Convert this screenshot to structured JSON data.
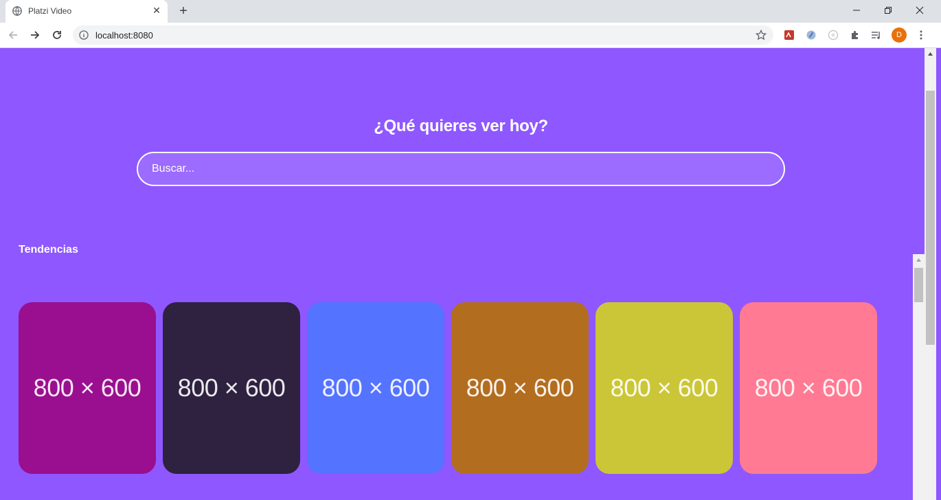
{
  "browser": {
    "tab_title": "Platzi Video",
    "url": "localhost:8080",
    "profile_initial": "D"
  },
  "hero": {
    "title": "¿Qué quieres ver hoy?",
    "search_placeholder": "Buscar..."
  },
  "trending": {
    "title": "Tendencias",
    "cards": [
      {
        "label": "800 × 600",
        "color": "#9a0f8f"
      },
      {
        "label": "800 × 600",
        "color": "#2e2240"
      },
      {
        "label": "800 × 600",
        "color": "#5473ff"
      },
      {
        "label": "800 × 600",
        "color": "#b36d1f"
      },
      {
        "label": "800 × 600",
        "color": "#cbc637"
      },
      {
        "label": "800 × 600",
        "color": "#ff7a92"
      }
    ]
  },
  "colors": {
    "page_background": "#8f57ff",
    "text": "#ffffff"
  }
}
